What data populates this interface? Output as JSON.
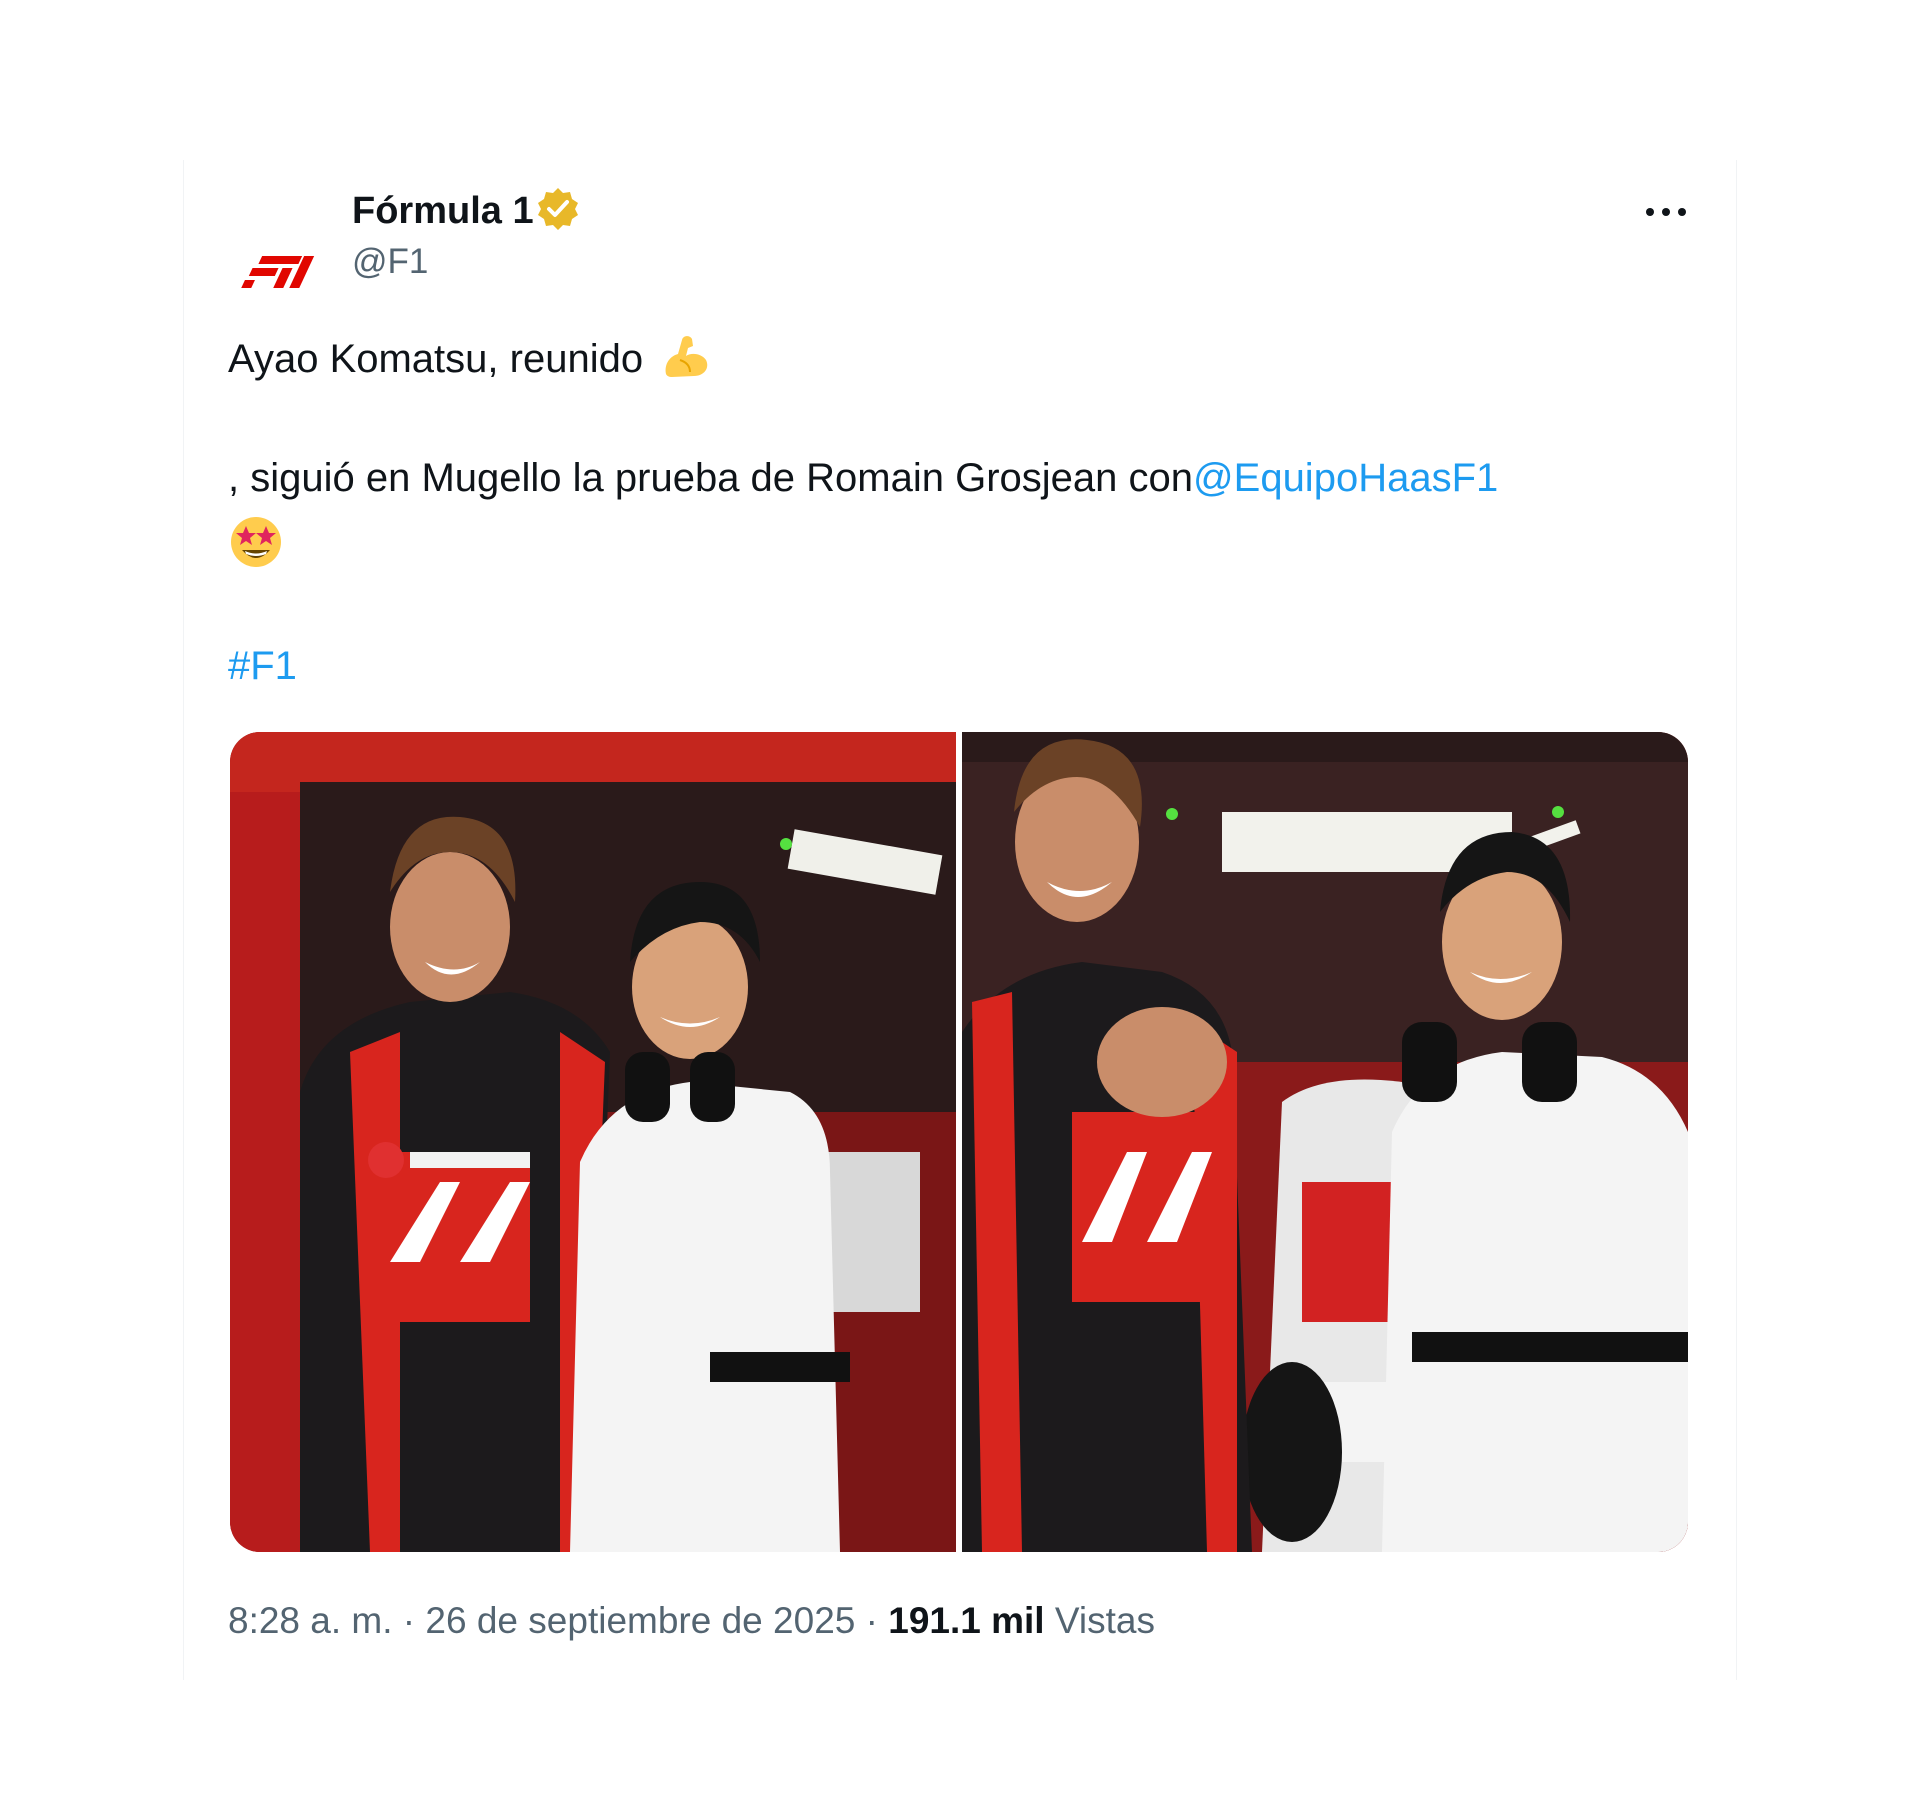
{
  "author": {
    "display_name": "Fórmula 1",
    "handle": "@F1",
    "brand_color": "#e10600",
    "verified_badge_color": "#e8b829",
    "avatar_icon": "f1-logo-icon"
  },
  "tweet": {
    "line1_text": "Ayao Komatsu, reunido",
    "line1_emoji": "flexed-biceps-emoji",
    "line2_text": ", siguió en Mugello la prueba de Romain Grosjean con",
    "line2_mention": "@EquipoHaasF1",
    "line3_emoji": "star-struck-emoji",
    "hashtag": "#F1",
    "link_color": "#1d9bf0"
  },
  "media": {
    "photos": [
      {
        "subject": "Grosjean and Komatsu laughing in the pit garage"
      },
      {
        "subject": "Grosjean smiling beside Komatsu, Haas car in the garage"
      }
    ]
  },
  "meta": {
    "time": "8:28 a. m.",
    "separator": " · ",
    "date": "26 de septiembre de 2025",
    "views_count": "191.1 mil",
    "views_label": "Vistas"
  }
}
